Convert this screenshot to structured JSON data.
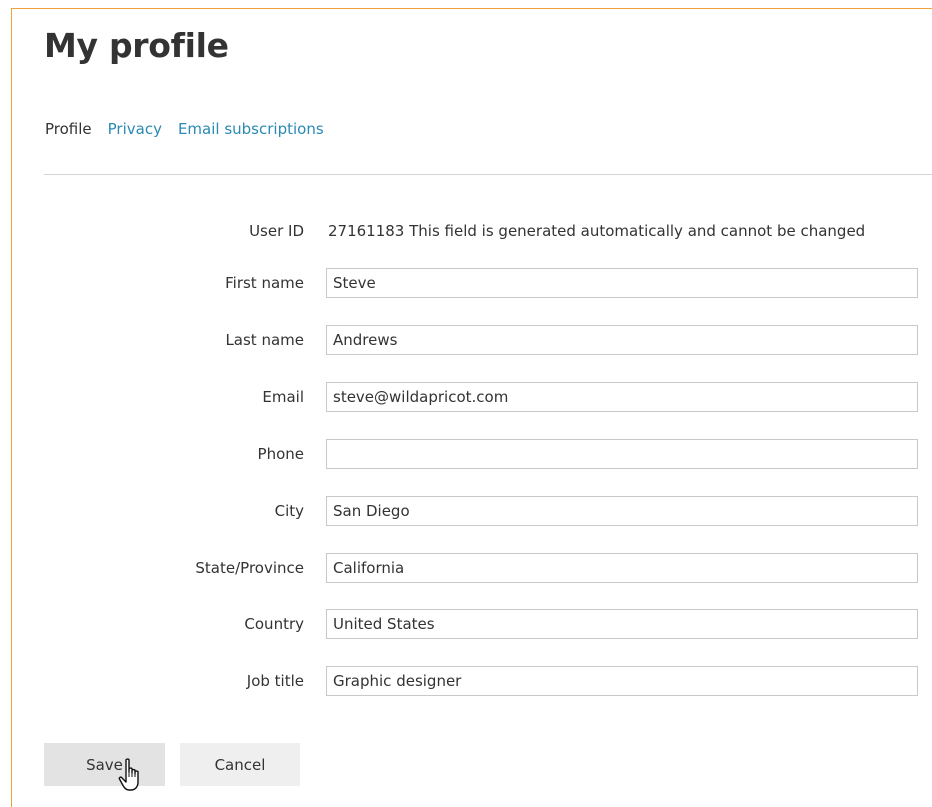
{
  "page": {
    "title": "My profile"
  },
  "tabs": [
    {
      "label": "Profile",
      "active": true
    },
    {
      "label": "Privacy",
      "active": false
    },
    {
      "label": "Email subscriptions",
      "active": false
    }
  ],
  "form": {
    "user_id": {
      "label": "User ID",
      "value": "27161183 This field is generated automatically and cannot be changed"
    },
    "fields": [
      {
        "label": "First name",
        "value": "Steve"
      },
      {
        "label": "Last name",
        "value": "Andrews"
      },
      {
        "label": "Email",
        "value": "steve@wildapricot.com"
      },
      {
        "label": "Phone",
        "value": ""
      },
      {
        "label": "City",
        "value": "San Diego"
      },
      {
        "label": "State/Province",
        "value": "California"
      },
      {
        "label": "Country",
        "value": "United States"
      },
      {
        "label": "Job title",
        "value": "Graphic designer"
      }
    ]
  },
  "actions": {
    "save_label": "Save",
    "cancel_label": "Cancel"
  },
  "colors": {
    "frame_border": "#f0a13a",
    "link": "#2a8ab4",
    "text": "#333333"
  },
  "icons": {
    "cursor": "hand-pointer-icon"
  }
}
